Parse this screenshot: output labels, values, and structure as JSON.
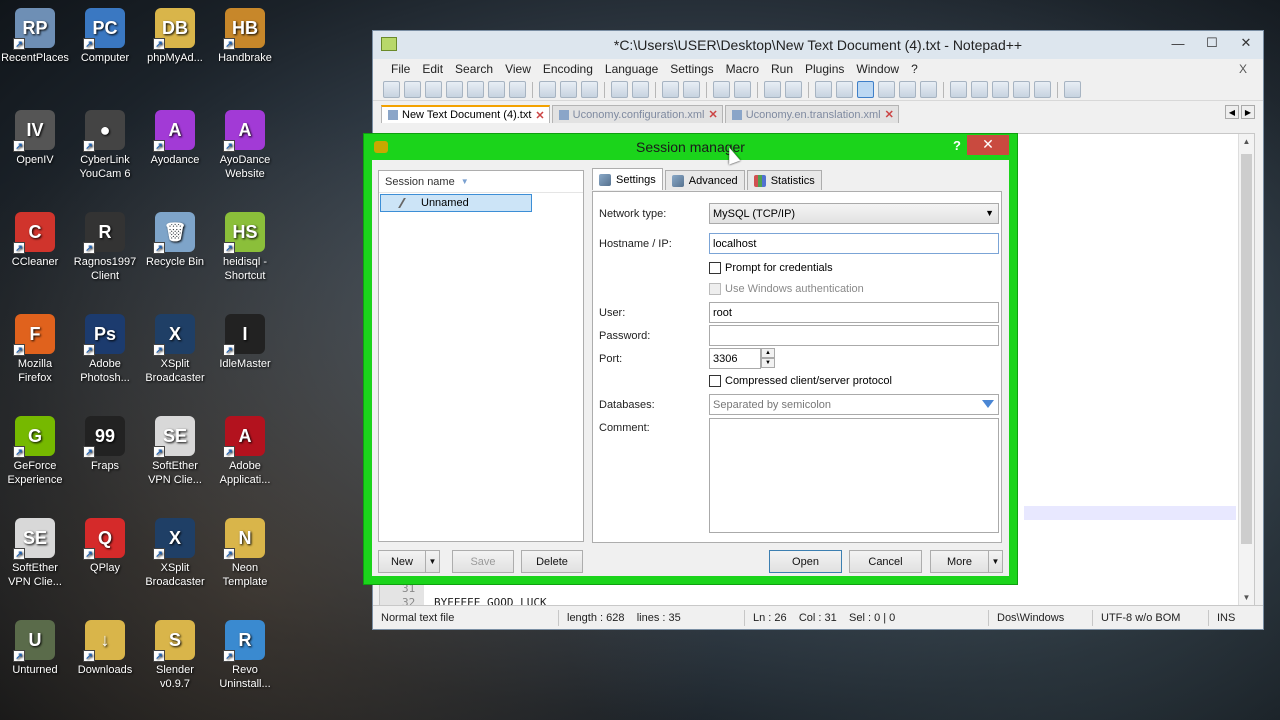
{
  "desktop": {
    "icons": [
      {
        "label": "RecentPlaces",
        "color": "#6e8fb5",
        "glyph": "RP"
      },
      {
        "label": "Computer",
        "color": "#3a78c2",
        "glyph": "PC"
      },
      {
        "label": "phpMyAd...",
        "color": "#d9b54a",
        "glyph": "DB"
      },
      {
        "label": "Handbrake",
        "color": "#c7872a",
        "glyph": "HB"
      },
      {
        "label": "OpenIV",
        "color": "#555555",
        "glyph": "IV"
      },
      {
        "label": "CyberLink YouCam 6",
        "color": "#444444",
        "glyph": "●"
      },
      {
        "label": "Ayodance",
        "color": "#a23ad6",
        "glyph": "A"
      },
      {
        "label": "AyoDance Website",
        "color": "#a23ad6",
        "glyph": "A"
      },
      {
        "label": "CCleaner",
        "color": "#d0342c",
        "glyph": "C"
      },
      {
        "label": "Ragnos1997 Client",
        "color": "#333333",
        "glyph": "R"
      },
      {
        "label": "Recycle Bin",
        "color": "#7ea4c9",
        "glyph": "🗑"
      },
      {
        "label": "heidisql - Shortcut",
        "color": "#8bbf3a",
        "glyph": "HS"
      },
      {
        "label": "Mozilla Firefox",
        "color": "#e0621d",
        "glyph": "F"
      },
      {
        "label": "Adobe Photosh...",
        "color": "#1c3b6e",
        "glyph": "Ps"
      },
      {
        "label": "XSplit Broadcaster",
        "color": "#1f3f66",
        "glyph": "X"
      },
      {
        "label": "IdleMaster",
        "color": "#222222",
        "glyph": "I"
      },
      {
        "label": "GeForce Experience",
        "color": "#76b900",
        "glyph": "G"
      },
      {
        "label": "Fraps",
        "color": "#222222",
        "glyph": "99"
      },
      {
        "label": "SoftEther VPN Clie...",
        "color": "#d8d8d8",
        "glyph": "SE"
      },
      {
        "label": "Adobe Applicati...",
        "color": "#b3121e",
        "glyph": "A"
      },
      {
        "label": "SoftEther VPN Clie...",
        "color": "#d8d8d8",
        "glyph": "SE"
      },
      {
        "label": "QPlay",
        "color": "#d52a2a",
        "glyph": "Q"
      },
      {
        "label": "XSplit Broadcaster",
        "color": "#1f3f66",
        "glyph": "X"
      },
      {
        "label": "Neon Template",
        "color": "#d9b54a",
        "glyph": "N"
      },
      {
        "label": "Unturned",
        "color": "#5a6b4a",
        "glyph": "U"
      },
      {
        "label": "Downloads",
        "color": "#d9b54a",
        "glyph": "↓"
      },
      {
        "label": "Slender v0.9.7",
        "color": "#d9b54a",
        "glyph": "S"
      },
      {
        "label": "Revo Uninstall...",
        "color": "#3a8ad0",
        "glyph": "R"
      }
    ]
  },
  "notepad": {
    "title": "*C:\\Users\\USER\\Desktop\\New Text Document (4).txt - Notepad++",
    "window_buttons": [
      "—",
      "☐",
      "✕"
    ],
    "menu": [
      "File",
      "Edit",
      "Search",
      "View",
      "Encoding",
      "Language",
      "Settings",
      "Macro",
      "Run",
      "Plugins",
      "Window",
      "?"
    ],
    "menu_close": "X",
    "tabs": [
      {
        "label": "New Text Document (4).txt",
        "active": true
      },
      {
        "label": "Uconomy.configuration.xml",
        "active": false
      },
      {
        "label": "Uconomy.en.translation.xml",
        "active": false
      }
    ],
    "editor_lines": [
      {
        "num": "31",
        "text": ""
      },
      {
        "num": "32",
        "text": "BYEEEEE GOOD LUCK"
      }
    ],
    "status": {
      "file_type": "Normal text file",
      "length_lines": "length : 628    lines : 35",
      "position": "Ln : 26    Col : 31    Sel : 0 | 0",
      "eol": "Dos\\Windows",
      "encoding": "UTF-8 w/o BOM",
      "mode": "INS"
    }
  },
  "session_manager": {
    "title": "Session manager",
    "help": "?",
    "close": "✕",
    "list_header": "Session name",
    "session_item": "Unnamed",
    "tabs": [
      "Settings",
      "Advanced",
      "Statistics"
    ],
    "labels": {
      "network_type": "Network type:",
      "hostname": "Hostname / IP:",
      "user": "User:",
      "password": "Password:",
      "port": "Port:",
      "databases": "Databases:",
      "comment": "Comment:"
    },
    "values": {
      "network_type": "MySQL (TCP/IP)",
      "hostname": "localhost",
      "user": "root",
      "password": "",
      "port": "3306",
      "databases_placeholder": "Separated by semicolon",
      "comment": ""
    },
    "checkboxes": {
      "prompt": "Prompt for credentials",
      "windows_auth": "Use Windows authentication",
      "compressed": "Compressed client/server protocol"
    },
    "buttons": {
      "new": "New",
      "save": "Save",
      "delete": "Delete",
      "open": "Open",
      "cancel": "Cancel",
      "more": "More"
    },
    "accent": "#1bd41b"
  }
}
